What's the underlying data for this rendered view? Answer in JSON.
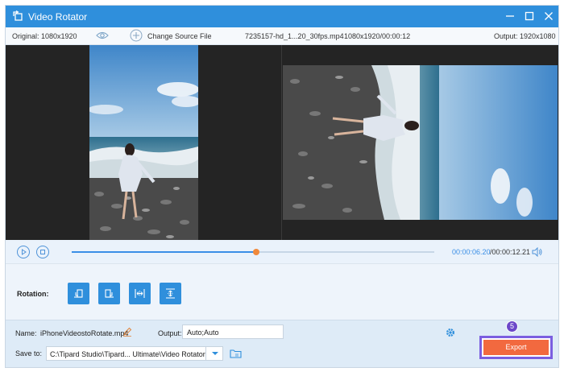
{
  "window": {
    "title": "Video Rotator"
  },
  "info": {
    "original_label": "Original: 1080x1920",
    "change_source_label": "Change Source File",
    "file_name": "7235157-hd_1...20_30fps.mp4",
    "file_meta": "1080x1920/00:00:12",
    "output_label": "Output: 1920x1080"
  },
  "playback": {
    "current_time": "00:00:06.20",
    "total_time": "/00:00:12.21",
    "progress": 0.508
  },
  "rotation": {
    "label": "Rotation:",
    "buttons": [
      "rotate-left",
      "rotate-right",
      "flip-horizontal",
      "flip-vertical"
    ]
  },
  "bottom": {
    "name_label": "Name:",
    "name_value": "iPhoneVideostoRotate.mp4",
    "output_label": "Output:",
    "output_value": "Auto;Auto",
    "save_label": "Save to:",
    "save_path": "C:\\Tipard Studio\\Tipard... Ultimate\\Video Rotator",
    "export_label": "Export",
    "step_badge": "5"
  },
  "colors": {
    "accent": "#2f8fdc",
    "export": "#f2693f",
    "highlight": "#7b5ee0",
    "scrubber": "#f0893c"
  }
}
